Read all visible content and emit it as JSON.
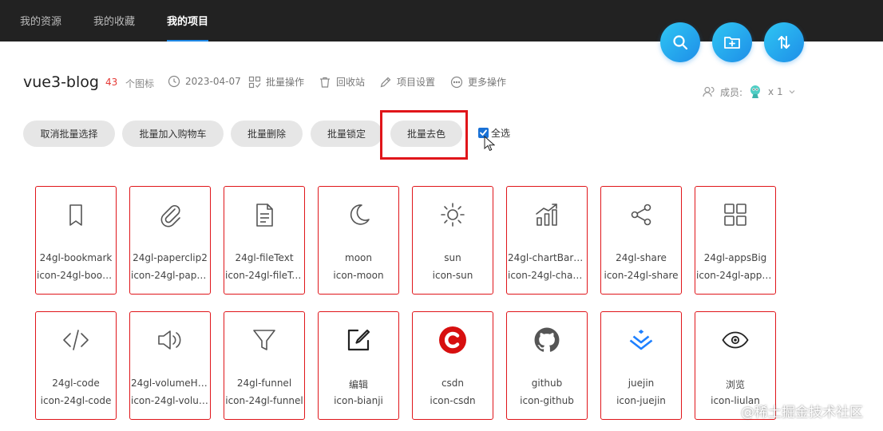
{
  "nav": {
    "tabs": [
      {
        "label": "我的资源"
      },
      {
        "label": "我的收藏"
      },
      {
        "label": "我的项目"
      }
    ]
  },
  "fab": {
    "icons": [
      "search-icon",
      "add-folder-icon",
      "sort-icon"
    ]
  },
  "project": {
    "title": "vue3-blog",
    "icon_count": "43",
    "icon_count_unit": "个图标",
    "date": "2023-04-07",
    "batch_label": "批量操作",
    "recycle_label": "回收站",
    "settings_label": "项目设置",
    "more_label": "更多操作",
    "members_label": "成员:",
    "members_count": "x 1"
  },
  "batch": {
    "buttons": [
      {
        "label": "取消批量选择"
      },
      {
        "label": "批量加入购物车"
      },
      {
        "label": "批量删除"
      },
      {
        "label": "批量锁定"
      },
      {
        "label": "批量去色"
      }
    ],
    "select_all_label": "全选",
    "select_all_checked": true
  },
  "icons": [
    {
      "name": "24gl-bookmark",
      "class": "icon-24gl-bookm...",
      "icon": "bookmark-icon",
      "color": "#555555"
    },
    {
      "name": "24gl-paperclip2",
      "class": "icon-24gl-paperc...",
      "icon": "paperclip-icon",
      "color": "#555555"
    },
    {
      "name": "24gl-fileText",
      "class": "icon-24gl-fileText",
      "icon": "file-text-icon",
      "color": "#555555"
    },
    {
      "name": "moon",
      "class": "icon-moon",
      "icon": "moon-icon",
      "color": "#555555"
    },
    {
      "name": "sun",
      "class": "icon-sun",
      "icon": "sun-icon",
      "color": "#555555"
    },
    {
      "name": "24gl-chartBarUp...",
      "class": "icon-24gl-chartB...",
      "icon": "chart-bar-up-icon",
      "color": "#555555"
    },
    {
      "name": "24gl-share",
      "class": "icon-24gl-share",
      "icon": "share-icon",
      "color": "#555555"
    },
    {
      "name": "24gl-appsBig",
      "class": "icon-24gl-appsBig",
      "icon": "apps-grid-icon",
      "color": "#555555"
    },
    {
      "name": "24gl-code",
      "class": "icon-24gl-code",
      "icon": "code-icon",
      "color": "#555555"
    },
    {
      "name": "24gl-volumeHigh",
      "class": "icon-24gl-volum...",
      "icon": "volume-high-icon",
      "color": "#555555"
    },
    {
      "name": "24gl-funnel",
      "class": "icon-24gl-funnel",
      "icon": "funnel-icon",
      "color": "#555555"
    },
    {
      "name": "编辑",
      "class": "icon-bianji",
      "icon": "edit-icon",
      "color": "#222222"
    },
    {
      "name": "csdn",
      "class": "icon-csdn",
      "icon": "csdn-logo-icon",
      "color": "#d70f0f"
    },
    {
      "name": "github",
      "class": "icon-github",
      "icon": "github-icon",
      "color": "#555555"
    },
    {
      "name": "juejin",
      "class": "icon-juejin",
      "icon": "juejin-logo-icon",
      "color": "#1e80ff"
    },
    {
      "name": "浏览",
      "class": "icon-liulan",
      "icon": "eye-icon",
      "color": "#222222"
    }
  ],
  "watermark": "@稀土掘金技术社区"
}
